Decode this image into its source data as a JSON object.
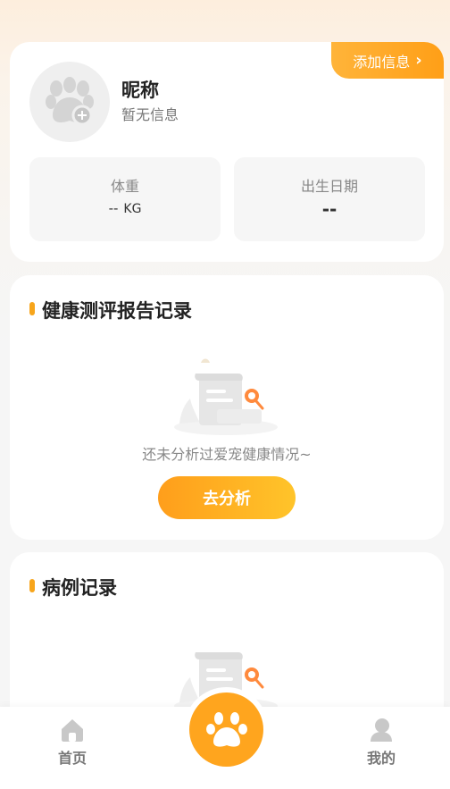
{
  "profile": {
    "add_info_label": "添加信息",
    "nickname": "昵称",
    "no_info": "暂无信息",
    "weight_label": "体重",
    "weight_value": "--",
    "weight_unit": "KG",
    "birth_label": "出生日期",
    "birth_value": "--"
  },
  "report": {
    "title": "健康测评报告记录",
    "empty_text": "还未分析过爱宠健康情况~",
    "button_label": "去分析"
  },
  "cases": {
    "title": "病例记录"
  },
  "nav": {
    "home_label": "首页",
    "mine_label": "我的"
  },
  "colors": {
    "accent": "#ffa51e",
    "accent_light": "#ffc42a"
  }
}
